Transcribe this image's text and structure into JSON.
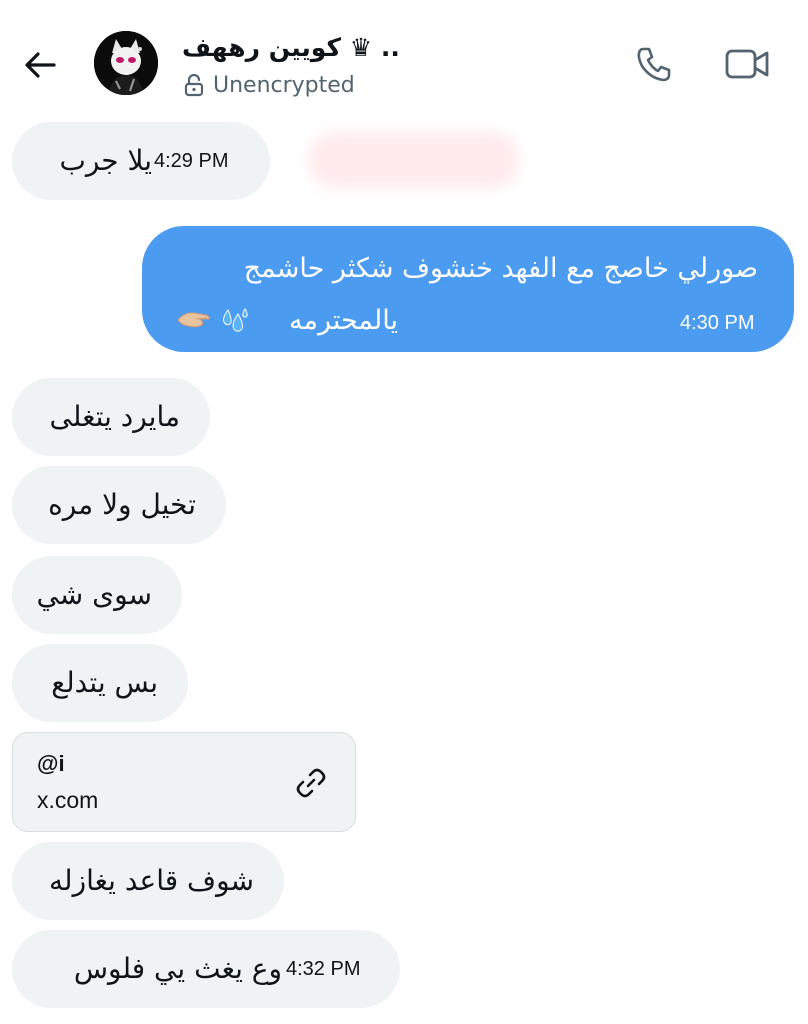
{
  "header": {
    "contact_name": "كويين رههف ♛ ..",
    "encryption_status": "Unencrypted",
    "icons": {
      "back": "back-arrow-icon",
      "lock": "unlocked-icon",
      "call": "phone-icon",
      "video": "video-camera-icon"
    }
  },
  "messages": {
    "m1": {
      "text": "يلا جرب",
      "time": "4:29 PM"
    },
    "m2": {
      "line1": "صورلي خاصج مع الفهد خنشوف شكثر حاشمج",
      "line2": "يالمحترمه",
      "emoji": "💦🤏🏻",
      "time": "4:30 PM"
    },
    "m3": {
      "text": "مايرد يتغلى"
    },
    "m4": {
      "text": "تخيل ولا مره"
    },
    "m5": {
      "text": "سوى شي"
    },
    "m6": {
      "text": "بس يتدلع"
    },
    "link_card": {
      "handle": "@i",
      "domain": "x.com"
    },
    "m7": {
      "text": "شوف قاعد يغازله"
    },
    "m8": {
      "text": "وع يغث يي فلوس",
      "time": "4:32 PM"
    }
  },
  "colors": {
    "outgoing_bubble": "#4b9bf0",
    "incoming_bubble": "#eff3f4",
    "muted_text": "#536471"
  }
}
